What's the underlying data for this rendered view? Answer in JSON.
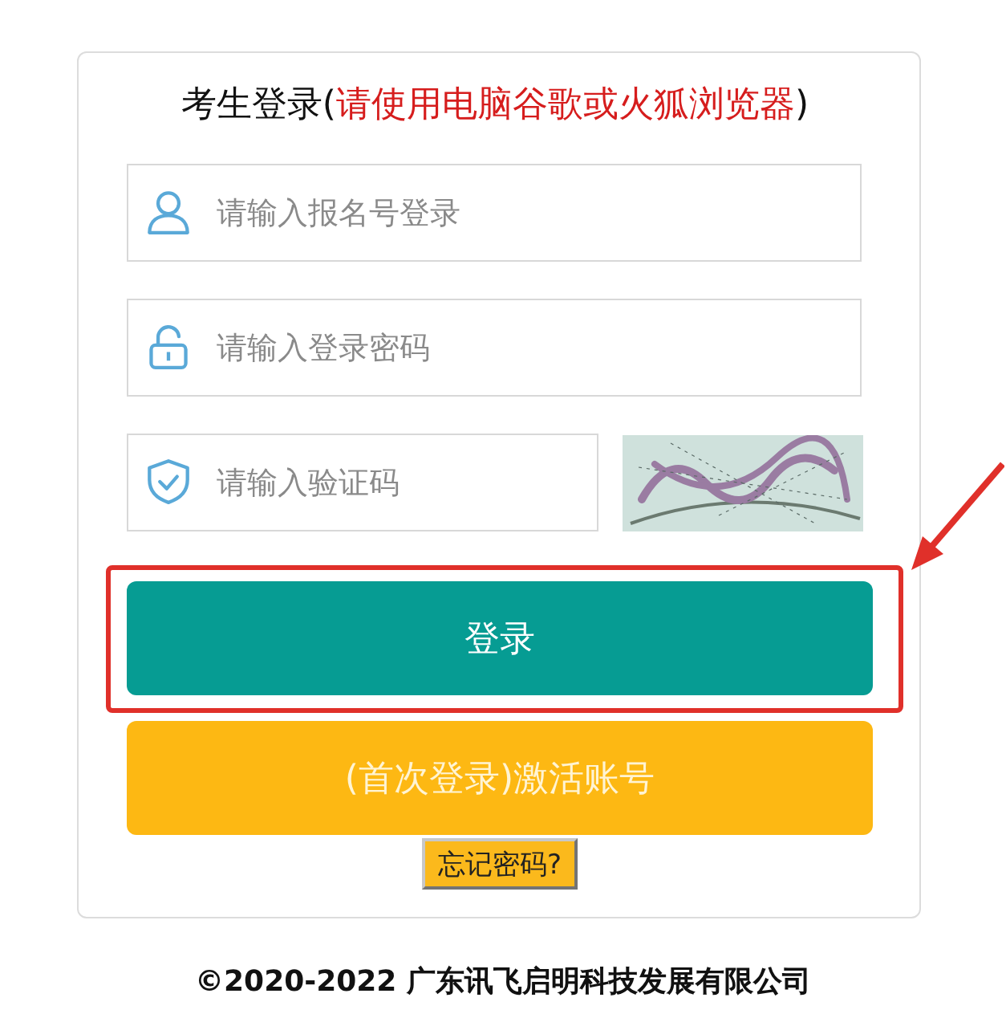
{
  "login": {
    "title": [
      {
        "kind": "plain",
        "text": "考生登录("
      },
      {
        "kind": "warning",
        "text": "请使用电脑谷歌或火狐浏览器"
      },
      {
        "kind": "plain",
        "text": ")"
      }
    ],
    "fields": [
      {
        "kind": "username",
        "placeholder": "请输入报名号登录"
      },
      {
        "kind": "password",
        "placeholder": "请输入登录密码"
      },
      {
        "kind": "captcha",
        "placeholder": "请输入验证码"
      }
    ],
    "buttons": [
      {
        "kind": "primary",
        "label": "登录",
        "highlighted": true
      },
      {
        "kind": "secondary",
        "label": "(首次登录)激活账号",
        "highlighted": false
      },
      {
        "kind": "link",
        "label": "忘记密码?",
        "highlighted": false
      }
    ]
  },
  "footer": {
    "copyright": "©2020-2022 广东讯飞启明科技发展有限公司"
  }
}
